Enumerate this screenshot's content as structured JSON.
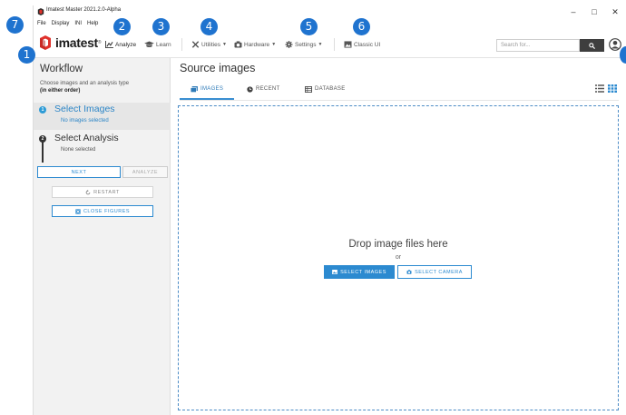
{
  "window": {
    "title": "Imatest Master 2021.2.0-Alpha",
    "minimize": "–",
    "maximize": "□",
    "close": "✕"
  },
  "menu": [
    "File",
    "Display",
    "INI",
    "Help"
  ],
  "logo": {
    "text": "imatest",
    "reg": "®"
  },
  "toolbar": {
    "analyze": "Analyze",
    "learn": "Learn",
    "utilities": "Utilities",
    "hardware": "Hardware",
    "settings": "Settings",
    "classic_ui": "Classic UI",
    "search_placeholder": "Search for...",
    "icons": {
      "analyze": "chart-icon",
      "learn": "graduation-cap-icon",
      "utilities": "tools-icon",
      "hardware": "camera-icon",
      "settings": "gear-icon",
      "classic_ui": "image-icon",
      "search": "search-icon",
      "user": "user-icon"
    }
  },
  "sidebar": {
    "title": "Workflow",
    "description": "Choose images and an analysis type",
    "description_bold": "(in either order)",
    "steps": [
      {
        "label": "Select Images",
        "status": "No images selected",
        "bullet": "1",
        "active": true
      },
      {
        "label": "Select Analysis",
        "status": "None selected",
        "bullet": "2",
        "active": false
      }
    ],
    "next": "NEXT",
    "analyze": "ANALYZE",
    "restart": "RESTART",
    "close_figures": "CLOSE FIGURES"
  },
  "main": {
    "title": "Source images",
    "tabs": [
      {
        "label": "IMAGES",
        "icon": "images-icon",
        "active": true
      },
      {
        "label": "RECENT",
        "icon": "clock-icon",
        "active": false
      },
      {
        "label": "DATABASE",
        "icon": "table-icon",
        "active": false
      }
    ],
    "view_icons": [
      "list-view-icon",
      "grid-view-icon"
    ],
    "drop_text": "Drop image files here",
    "or": "or",
    "select_images": "SELECT IMAGES",
    "select_camera": "SELECT CAMERA"
  },
  "callouts": [
    "1",
    "2",
    "3",
    "4",
    "5",
    "6",
    "7"
  ],
  "colors": {
    "accent": "#2c8ad0",
    "badge": "#1f73cf",
    "logo_red": "#e0312b",
    "dark": "#3e3e3e",
    "sidebar_bg": "#f2f2f2"
  }
}
